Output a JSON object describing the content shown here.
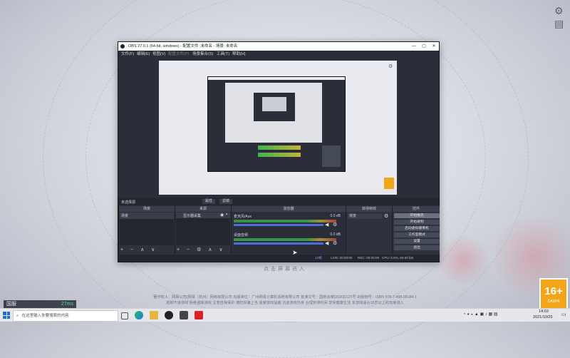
{
  "obs": {
    "title": "OBS 27.0.1 (64-bit, windows) - 配置文件: 未命名 - 场景: 未命名",
    "menu": [
      "文件(F)",
      "编辑(E)",
      "视图(V)",
      "配置文件(P)",
      "场景集合(S)",
      "工具(T)",
      "帮助(H)"
    ],
    "no_source": "未选择源",
    "props_btn": "属性",
    "filters_btn": "滤镜",
    "docks": {
      "scenes": "场景",
      "sources": "来源",
      "mixer": "混音器",
      "transitions": "转场特效",
      "controls": "控件"
    },
    "scene_item": "场景",
    "source_item": "显示器采集",
    "mixer_tracks": [
      {
        "name": "桌面音频",
        "db": "0.0 dB"
      },
      {
        "name": "麦克风/Aux",
        "db": "0.0 dB"
      }
    ],
    "transition_value": "渐变",
    "controls": [
      "开始推流",
      "开始录制",
      "启动虚拟摄像机",
      "工作室模式",
      "设置",
      "退出"
    ],
    "statusbar": {
      "live": "LIVE: 00:00:00",
      "rec": "REC: 00:00:00",
      "cpu": "CPU: 0.5%, 60.00 fps",
      "dropped": "12帧"
    }
  },
  "desktop": {
    "click_text": "点击屏幕进入",
    "copyright_line1": "著作权人：网易公司(网易（杭州）网络有限公司 出版单位：广州网易计算机系统有限公司 批准文号：国新出审[2020]1125号 出版物号：ISBN 978-7-498-08184-1",
    "copyright_line2": "抵制不良游戏 拒绝盗版游戏 注意自我保护 谨防受骗上当 适度游戏益脑 沉迷游戏伤身 合理安排时间 享受健康生活 本游戏适合16岁以上的玩家进入",
    "region_label": "国服",
    "ping": "27ms",
    "age_rating": "16+",
    "age_sub": "CADPA"
  },
  "taskbar": {
    "search_placeholder": "在这里输入你要搜索的内容",
    "time": "14:03",
    "date": "2021/10/25"
  },
  "colors": {
    "obs_bg": "#2b2e38",
    "accent_age": "#f2a51a",
    "meter_green": "#3fb24f",
    "meter_yellow": "#c6b23a"
  }
}
